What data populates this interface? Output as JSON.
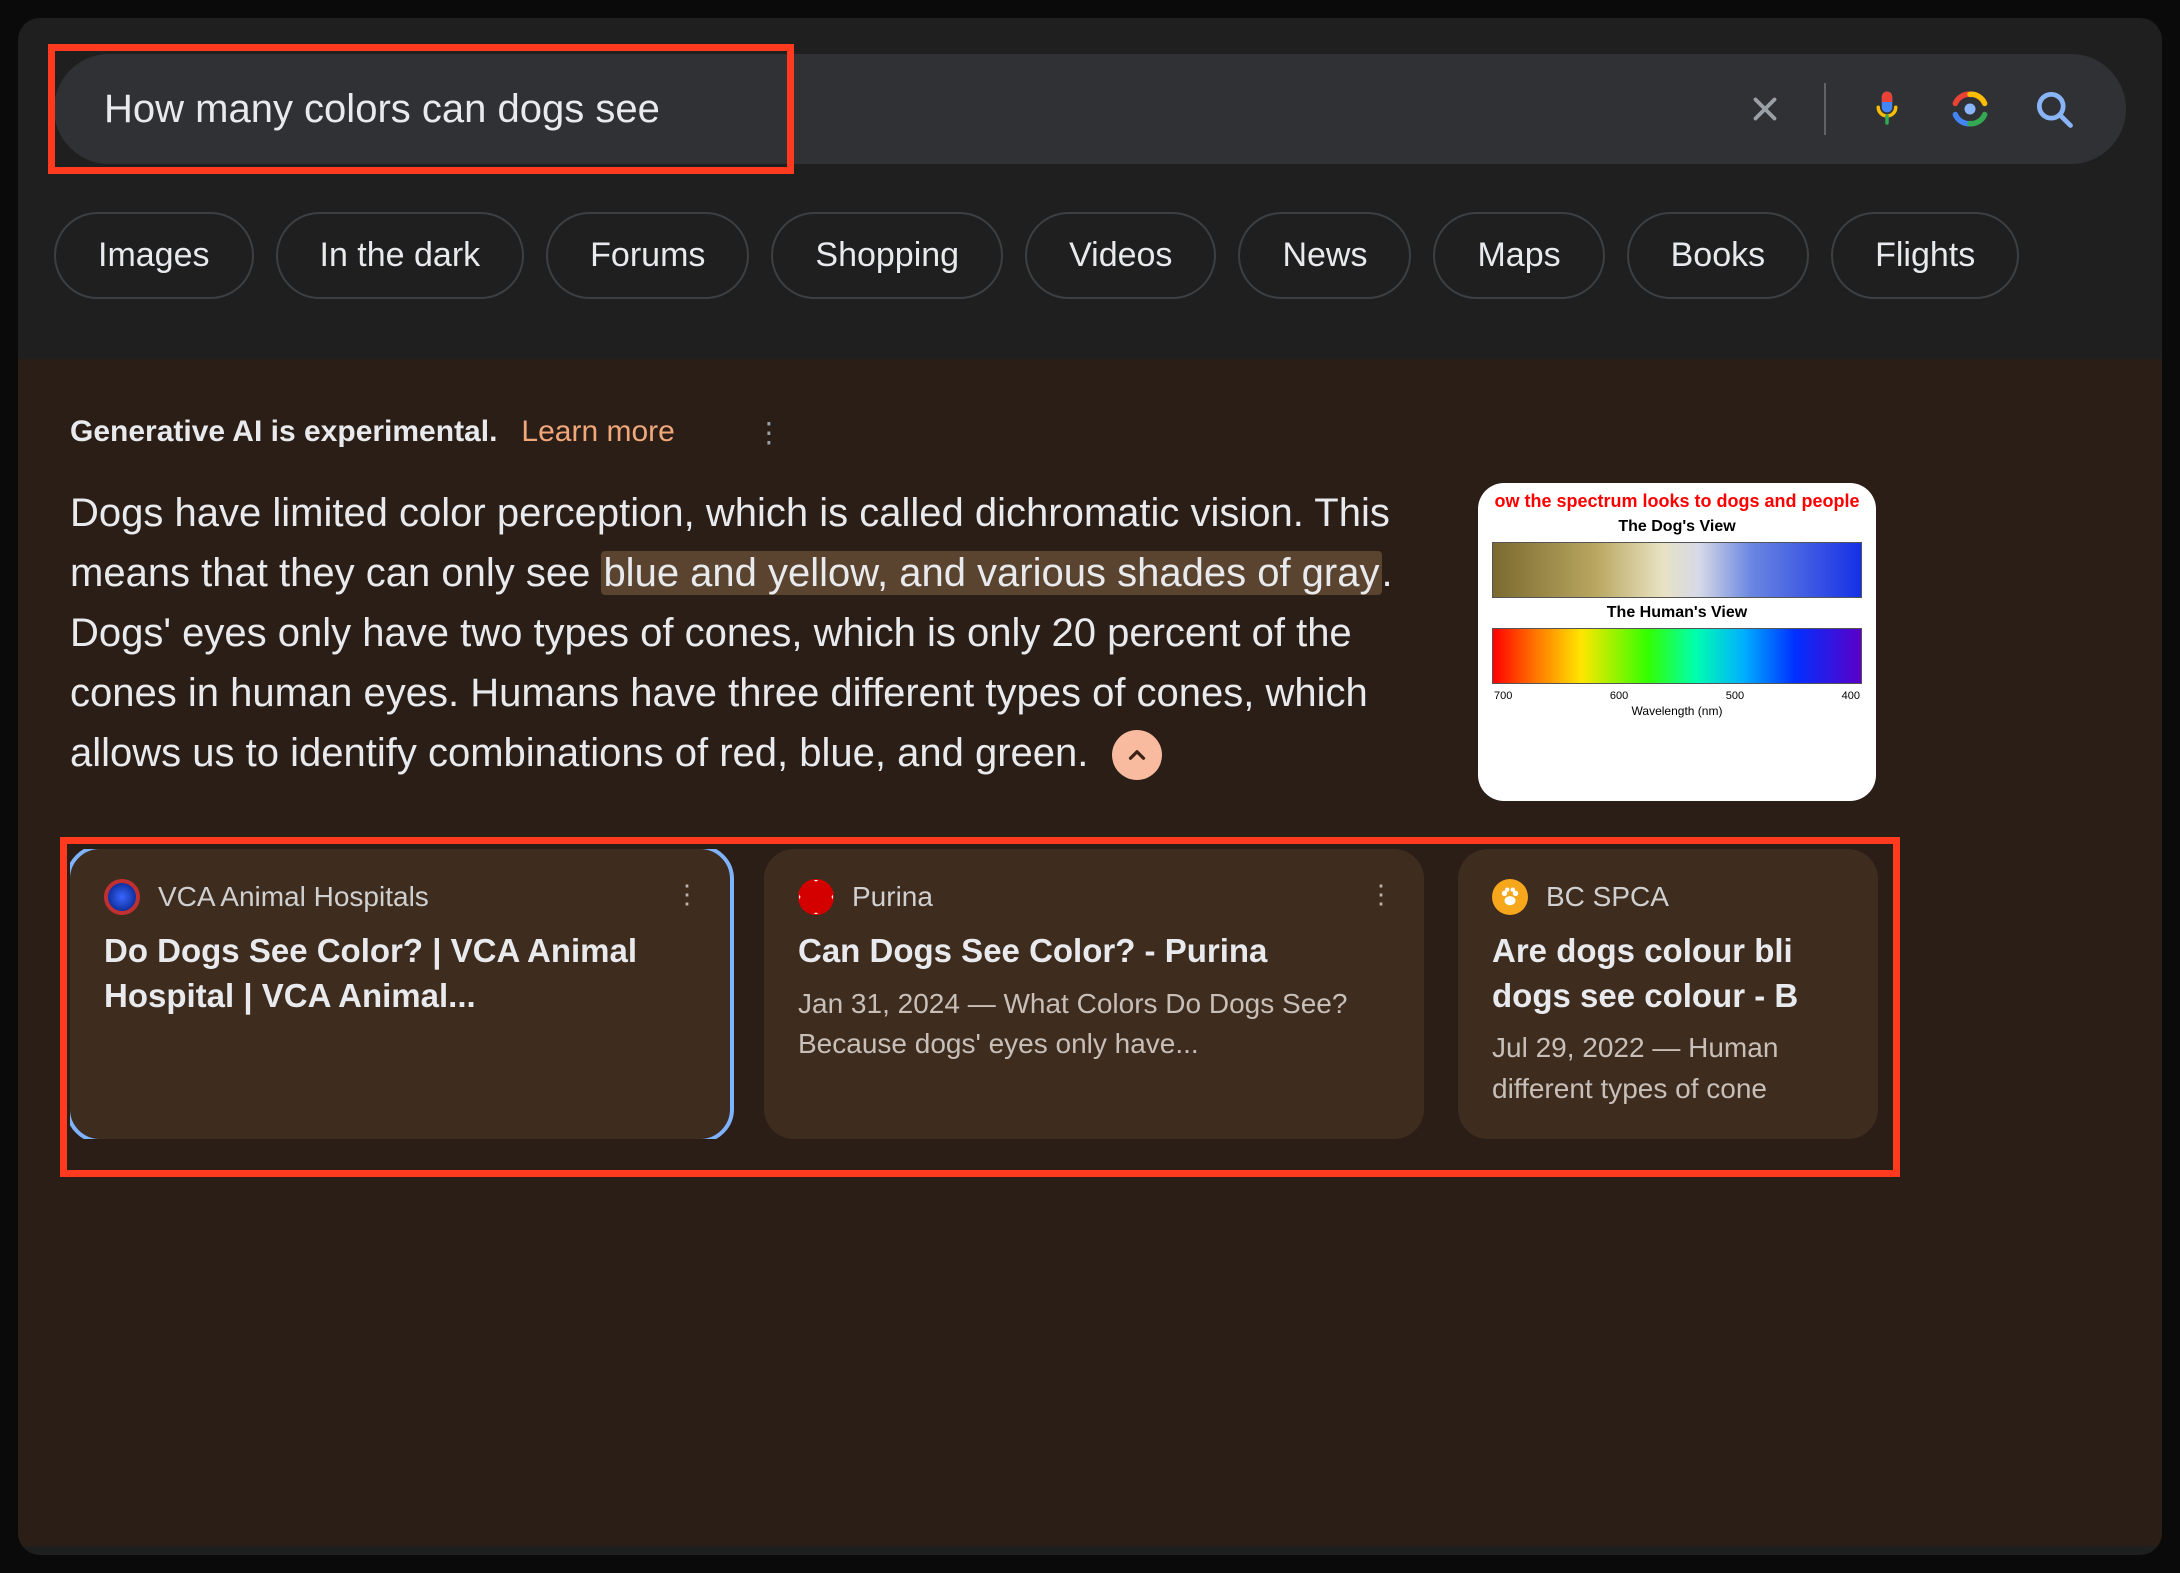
{
  "search": {
    "query": "How many colors can dogs see"
  },
  "chips": [
    "Images",
    "In the dark",
    "Forums",
    "Shopping",
    "Videos",
    "News",
    "Maps",
    "Books",
    "Flights"
  ],
  "ai": {
    "disclaimer": "Generative AI is experimental.",
    "learn_more": "Learn more",
    "text_parts": {
      "p1": "Dogs have limited color perception, which is called dichro­matic vision. This means that they can only see ",
      "hl1": "blue and yellow, and various shades of gray",
      "p2": ". Dogs' eyes only have two types of cones, which is only 20 percent of the cones in human eyes. Humans have three different types of cones, which allows us to identify combinations of red, blue, and green."
    },
    "thumb": {
      "title": "ow the spectrum looks to dogs and people",
      "dog_label": "The Dog's View",
      "human_label": "The Human's View",
      "axis_label": "Wavelength (nm)",
      "ticks": [
        "700",
        "600",
        "500",
        "400"
      ]
    }
  },
  "cards": [
    {
      "source": "VCA Animal Hospitals",
      "title": "Do Dogs See Color? | VCA Animal Hospital | VCA Animal...",
      "snippet": ""
    },
    {
      "source": "Purina",
      "title": "Can Dogs See Color? - Purina",
      "snippet": "Jan 31, 2024 — What Colors Do Dogs See? Because dogs' eyes only have..."
    },
    {
      "source": "BC SPCA",
      "title": "Are dogs colour bli dogs see colour - B",
      "snippet": "Jul 29, 2022 — Human different types of cone"
    }
  ]
}
